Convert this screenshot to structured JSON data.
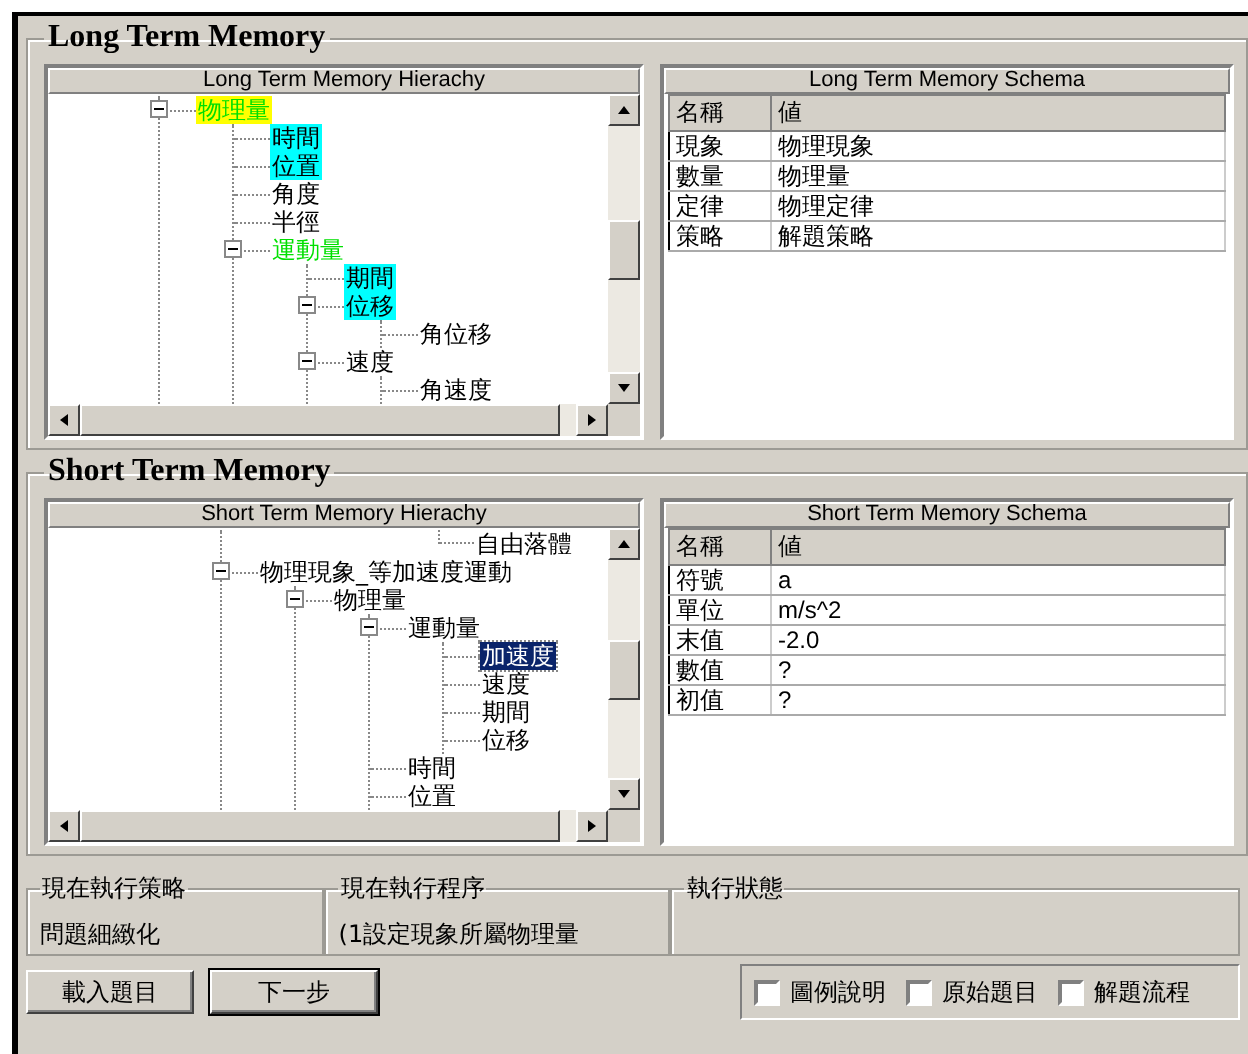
{
  "groups": [
    {
      "title": "Long Term Memory",
      "tree": {
        "title": "Long Term Memory Hierachy",
        "nodes": [
          {
            "kind": "node",
            "label": "物理量",
            "selected": false,
            "expanded": true,
            "active": true,
            "color": "#ffff00",
            "children": [
              {
                "kind": "node",
                "label": "時間",
                "selected": false,
                "color": "#00ffff"
              },
              {
                "kind": "node",
                "label": "位置",
                "selected": false,
                "color": "#00ffff"
              },
              {
                "kind": "node",
                "label": "角度",
                "selected": false
              },
              {
                "kind": "node",
                "label": "半徑",
                "selected": false
              },
              {
                "kind": "node",
                "label": "運動量",
                "selected": false,
                "expanded": true,
                "active": true,
                "children": [
                  {
                    "kind": "node",
                    "label": "期間",
                    "selected": false,
                    "color": "#00ffff"
                  },
                  {
                    "kind": "node",
                    "label": "位移",
                    "selected": false,
                    "expanded": true,
                    "color": "#00ffff",
                    "children": [
                      {
                        "kind": "node",
                        "label": "角位移",
                        "selected": false
                      }
                    ]
                  },
                  {
                    "kind": "node",
                    "label": "速度",
                    "selected": false,
                    "expanded": true,
                    "children": [
                      {
                        "kind": "node",
                        "label": "角速度",
                        "selected": false
                      }
                    ]
                  }
                ]
              }
            ]
          }
        ]
      },
      "schema": {
        "title": "Long Term Memory Schema",
        "columns": [
          "名稱",
          "値"
        ],
        "rows": [
          [
            "現象",
            "物理現象"
          ],
          [
            "數量",
            "物理量"
          ],
          [
            "定律",
            "物理定律"
          ],
          [
            "策略",
            "解題策略"
          ]
        ]
      }
    },
    {
      "title": "Short Term Memory",
      "tree": {
        "title": "Short Term Memory Hierachy",
        "nodes": [
          {
            "kind": "tail",
            "label": "自由落體",
            "selected": false
          },
          {
            "kind": "node",
            "label": "物理現象_等加速度運動",
            "selected": false,
            "expanded": true,
            "children": [
              {
                "kind": "node",
                "label": "物理量",
                "selected": false,
                "expanded": true,
                "children": [
                  {
                    "kind": "node",
                    "label": "運動量",
                    "selected": false,
                    "expanded": true,
                    "children": [
                      {
                        "kind": "node",
                        "label": "加速度",
                        "selected": true
                      },
                      {
                        "kind": "node",
                        "label": "速度",
                        "selected": false
                      },
                      {
                        "kind": "node",
                        "label": "期間",
                        "selected": false
                      },
                      {
                        "kind": "node",
                        "label": "位移",
                        "selected": false
                      }
                    ]
                  },
                  {
                    "kind": "node",
                    "label": "時間",
                    "selected": false
                  },
                  {
                    "kind": "node",
                    "label": "位置",
                    "selected": false
                  }
                ]
              }
            ]
          }
        ]
      },
      "schema": {
        "title": "Short Term Memory Schema",
        "columns": [
          "名稱",
          "値"
        ],
        "rows": [
          [
            "符號",
            "a"
          ],
          [
            "單位",
            "m/s^2"
          ],
          [
            "末值",
            "-2.0"
          ],
          [
            "數值",
            "?"
          ],
          [
            "初值",
            "?"
          ]
        ]
      }
    }
  ],
  "status": [
    {
      "title": "現在執行策略",
      "value": "問題細緻化"
    },
    {
      "title": "現在執行程序",
      "value": "(1設定現象所屬物理量"
    },
    {
      "title": "執行狀態"
    }
  ],
  "buttons": [
    "載入題目",
    "下一步"
  ],
  "checkboxes": [
    {
      "label": "圖例說明",
      "checked": false
    },
    {
      "label": "原始題目",
      "checked": false
    },
    {
      "label": "解題流程",
      "checked": false
    }
  ]
}
